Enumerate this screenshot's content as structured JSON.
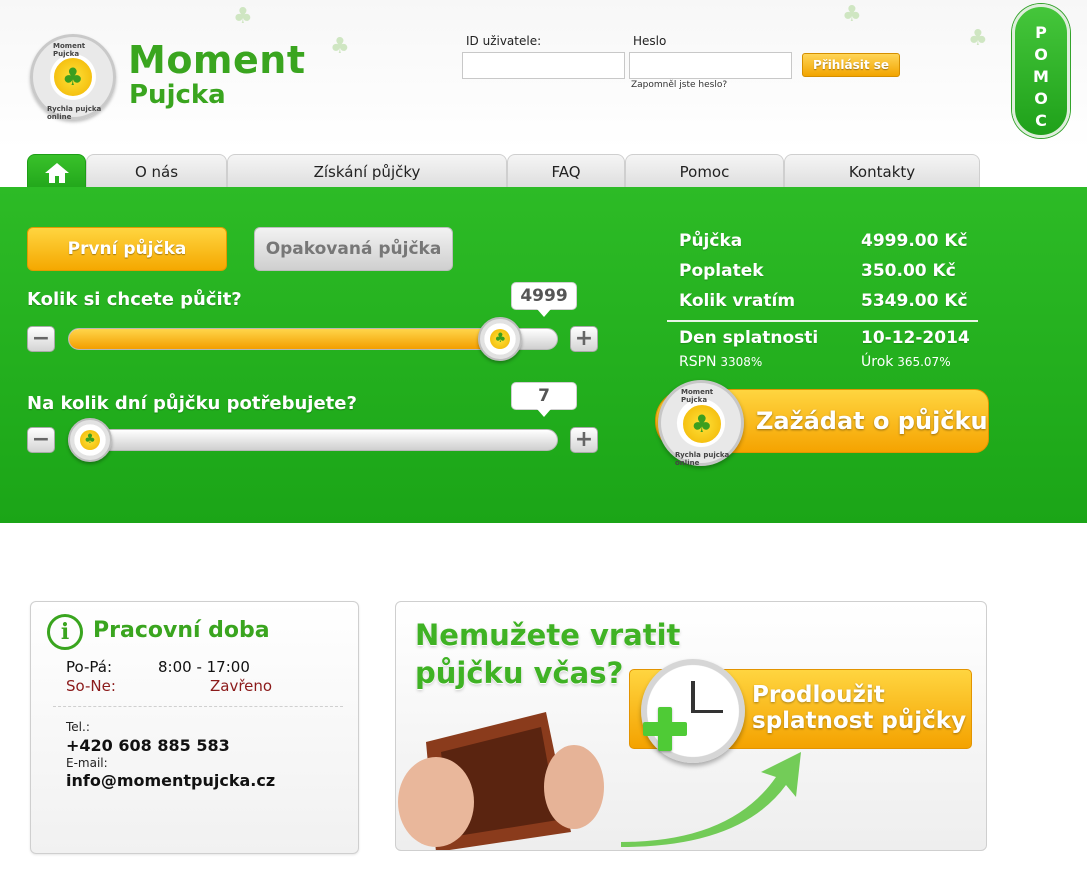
{
  "brand": {
    "name_line1": "Moment",
    "name_line2": "Pujcka",
    "badge_top": "Moment Pujcka",
    "badge_bottom": "Rychla pujcka online"
  },
  "login": {
    "user_label": "ID uživatele:",
    "password_label": "Heslo",
    "user_value": "",
    "password_value": "",
    "submit_label": "Přihlásit se",
    "forgot_label": "Zapomněl jste heslo?"
  },
  "side_help": {
    "letters": [
      "P",
      "O",
      "M",
      "O",
      "C"
    ]
  },
  "nav": {
    "home_icon": "home-icon",
    "tabs": [
      "O nás",
      "Získání půjčky",
      "FAQ",
      "Pomoc",
      "Kontakty"
    ]
  },
  "calculator": {
    "first_loan_label": "První půjčka",
    "repeat_loan_label": "Opakovaná půjčka",
    "amount_question": "Kolik si chcete půčit?",
    "amount_value": "4999",
    "amount_fraction": 0.92,
    "days_question": "Na kolik dní půjčku potřebujete?",
    "days_value": "7",
    "days_fraction": 0.0,
    "minus_label": "−",
    "plus_label": "+"
  },
  "summary": {
    "rows": [
      {
        "label": "Půjčka",
        "value": "4999.00 Kč"
      },
      {
        "label": "Poplatek",
        "value": "350.00 Kč"
      },
      {
        "label": "Kolik vratím",
        "value": "5349.00 Kč"
      }
    ],
    "due_label": "Den splatnosti",
    "due_value": "10-12-2014",
    "rpsn_label": "RSPN",
    "rpsn_value": "3308%",
    "rate_label": "Úrok",
    "rate_value": "365.07%",
    "apply_label": "Zažádat o půjčku"
  },
  "hours": {
    "title": "Pracovní doba",
    "weekdays_label": "Po-Pá:",
    "weekdays_value": "8:00 - 17:00",
    "weekend_label": "So-Ne:",
    "weekend_value": "Zavřeno",
    "tel_label": "Tel.:",
    "tel_value": "+420 608 885 583",
    "email_label": "E-mail:",
    "email_value": "info@momentpujcka.cz"
  },
  "promo": {
    "headline_line1": "Nemužete vratit",
    "headline_line2": "půjčku včas?",
    "extend_line1": "Prodloužit",
    "extend_line2": "splatnost půjčky"
  },
  "colors": {
    "brand_green": "#3aa51f",
    "panel_green": "#24b01e",
    "accent_orange": "#f5a800"
  }
}
